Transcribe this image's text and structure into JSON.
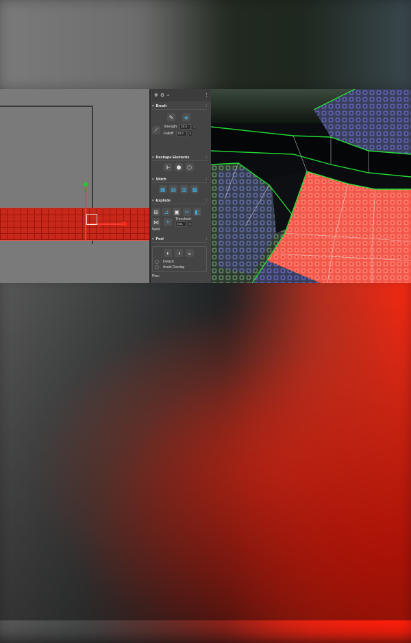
{
  "panel": {
    "sections": {
      "brush": {
        "title": "Brush",
        "strength_label": "Strength:",
        "strength_value": "20.0",
        "falloff_label": "Falloff:",
        "falloff_value": "20.0"
      },
      "reshape": {
        "title": "Reshape Elements"
      },
      "stitch": {
        "title": "Stitch"
      },
      "explode": {
        "title": "Explode",
        "weld_label": "Weld",
        "threshold_label": "Threshold:",
        "threshold_value": "0.01"
      },
      "peel": {
        "title": "Peel",
        "detach_label": "Detach",
        "avoid_overlap_label": "Avoid Overlap",
        "next_label": "Pins:"
      }
    }
  },
  "colors": {
    "selection_red": "#c8281a",
    "uv_edge_green": "#22dd33",
    "panel_bg": "#444444",
    "viewport_gray": "#7a7a7a"
  }
}
